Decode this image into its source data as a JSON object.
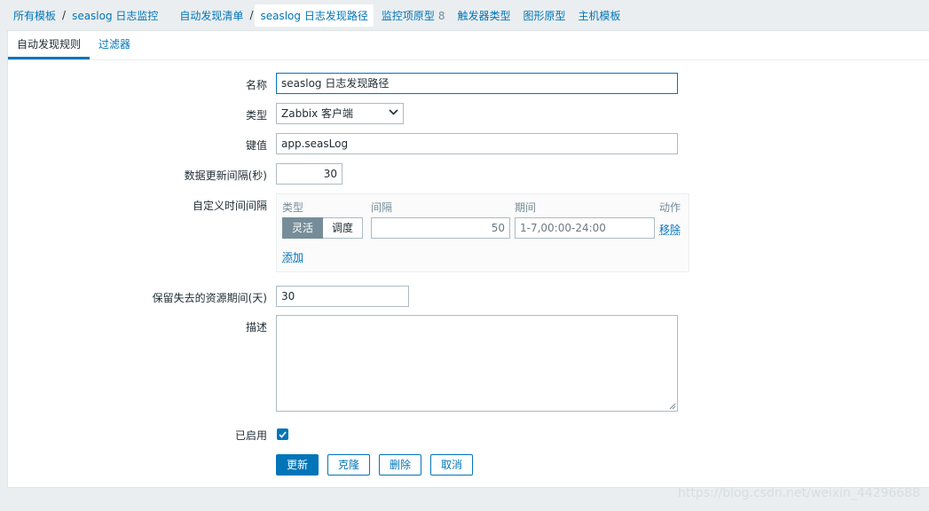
{
  "breadcrumbs": {
    "all_templates": "所有模板",
    "separator": "/",
    "template": "seaslog 日志监控",
    "discovery_list": "自动发现清单",
    "current": "seaslog 日志发现路径",
    "item_prototypes": "监控项原型",
    "item_prototypes_count": "8",
    "trigger_types": "触发器类型",
    "graph_prototypes": "图形原型",
    "host_templates": "主机模板"
  },
  "tabs": [
    {
      "label": "自动发现规则",
      "active": true
    },
    {
      "label": "过滤器",
      "active": false
    }
  ],
  "form": {
    "name": {
      "label": "名称",
      "value": "seaslog 日志发现路径"
    },
    "type": {
      "label": "类型",
      "value": "Zabbix 客户端"
    },
    "key": {
      "label": "键值",
      "value": "app.seasLog"
    },
    "interval": {
      "label": "数据更新间隔(秒)",
      "value": "30"
    },
    "custom_intervals": {
      "label": "自定义时间间隔",
      "headers": {
        "type": "类型",
        "interval": "间隔",
        "period": "期间",
        "action": "动作"
      },
      "row": {
        "flexible": "灵活",
        "scheduling": "调度",
        "interval_value": "50",
        "period_value": "1-7,00:00-24:00",
        "remove": "移除"
      },
      "add": "添加"
    },
    "lifetime": {
      "label": "保留失去的资源期间(天)",
      "value": "30"
    },
    "description": {
      "label": "描述",
      "value": ""
    },
    "enabled": {
      "label": "已启用",
      "checked": true
    }
  },
  "buttons": {
    "update": "更新",
    "clone": "克隆",
    "delete": "删除",
    "cancel": "取消"
  },
  "watermark": "https://blog.csdn.net/weixin_44296688",
  "colors": {
    "accent": "#0275b8",
    "background": "#ebeef0"
  }
}
